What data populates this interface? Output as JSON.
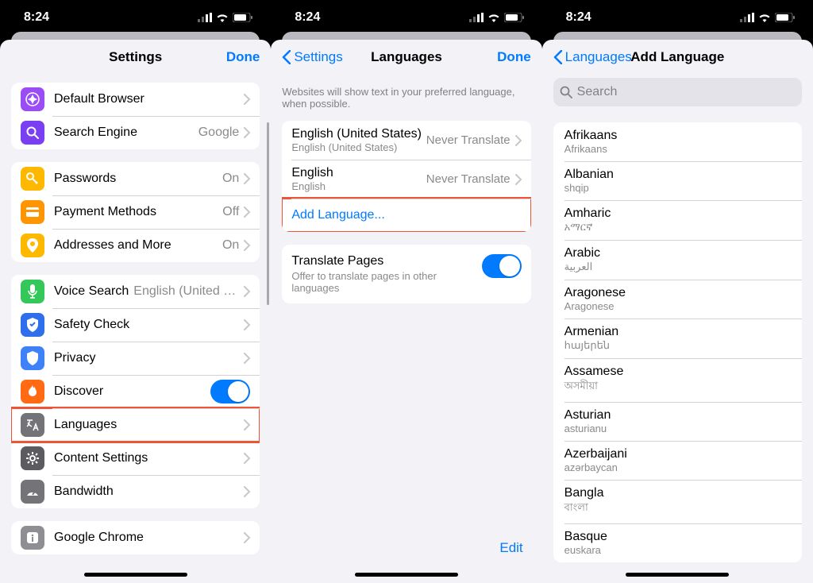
{
  "status": {
    "time": "8:24"
  },
  "screen1": {
    "title": "Settings",
    "done": "Done",
    "rows": {
      "default_browser": {
        "label": "Default Browser"
      },
      "search_engine": {
        "label": "Search Engine",
        "value": "Google"
      },
      "passwords": {
        "label": "Passwords",
        "value": "On"
      },
      "payment": {
        "label": "Payment Methods",
        "value": "Off"
      },
      "addresses": {
        "label": "Addresses and More",
        "value": "On"
      },
      "voice": {
        "label": "Voice Search",
        "value": "English (United St..."
      },
      "safety": {
        "label": "Safety Check"
      },
      "privacy": {
        "label": "Privacy"
      },
      "discover": {
        "label": "Discover"
      },
      "languages": {
        "label": "Languages"
      },
      "content": {
        "label": "Content Settings"
      },
      "bandwidth": {
        "label": "Bandwidth"
      },
      "chrome": {
        "label": "Google Chrome"
      }
    }
  },
  "screen2": {
    "back": "Settings",
    "title": "Languages",
    "done": "Done",
    "footer": "Websites will show text in your preferred language, when possible.",
    "langs": [
      {
        "title": "English (United States)",
        "sub": "English (United States)",
        "action": "Never Translate"
      },
      {
        "title": "English",
        "sub": "English",
        "action": "Never Translate"
      }
    ],
    "add": "Add Language...",
    "translate": {
      "title": "Translate Pages",
      "sub": "Offer to translate pages in other languages"
    },
    "edit": "Edit"
  },
  "screen3": {
    "back": "Languages",
    "title": "Add Language",
    "search_placeholder": "Search",
    "list": [
      {
        "name": "Afrikaans",
        "native": "Afrikaans"
      },
      {
        "name": "Albanian",
        "native": "shqip"
      },
      {
        "name": "Amharic",
        "native": "አማርኛ"
      },
      {
        "name": "Arabic",
        "native": "العربية"
      },
      {
        "name": "Aragonese",
        "native": "Aragonese"
      },
      {
        "name": "Armenian",
        "native": "հայերեն"
      },
      {
        "name": "Assamese",
        "native": "অসমীয়া"
      },
      {
        "name": "Asturian",
        "native": "asturianu"
      },
      {
        "name": "Azerbaijani",
        "native": "azərbaycan"
      },
      {
        "name": "Bangla",
        "native": "বাংলা"
      },
      {
        "name": "Basque",
        "native": "euskara"
      }
    ]
  }
}
